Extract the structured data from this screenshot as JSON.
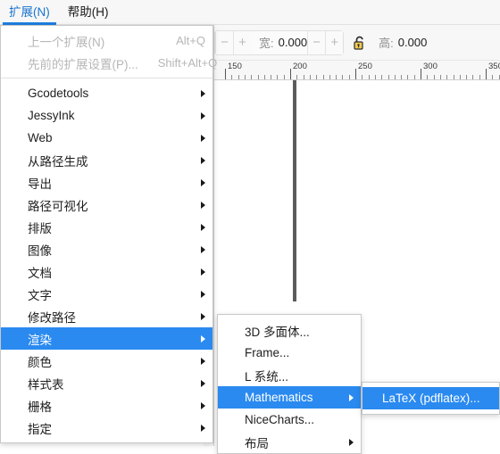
{
  "menubar": {
    "items": [
      {
        "label": "扩展(N)",
        "active": true
      },
      {
        "label": "帮助(H)",
        "active": false
      }
    ]
  },
  "toolbar": {
    "width_label": "宽:",
    "width_value": "0.000",
    "height_label": "高:",
    "height_value": "0.000",
    "lock_icon": "unlocked-padlock-icon",
    "minus_label": "−",
    "plus_label": "+"
  },
  "ruler": {
    "unit_marks": [
      "150",
      "200",
      "250",
      "300",
      "350"
    ]
  },
  "menus": {
    "extensions": {
      "title": "扩展(N)",
      "items": [
        {
          "label": "上一个扩展(N)",
          "accel": "Alt+Q",
          "disabled": true,
          "submenu": false
        },
        {
          "label": "先前的扩展设置(P)...",
          "accel": "Shift+Alt+Q",
          "disabled": true,
          "submenu": false
        },
        {
          "separator": true
        },
        {
          "label": "Gcodetools",
          "submenu": true
        },
        {
          "label": "JessyInk",
          "submenu": true
        },
        {
          "label": "Web",
          "submenu": true
        },
        {
          "label": "从路径生成",
          "submenu": true
        },
        {
          "label": "导出",
          "submenu": true
        },
        {
          "label": "路径可视化",
          "submenu": true
        },
        {
          "label": "排版",
          "submenu": true
        },
        {
          "label": "图像",
          "submenu": true
        },
        {
          "label": "文档",
          "submenu": true
        },
        {
          "label": "文字",
          "submenu": true
        },
        {
          "label": "修改路径",
          "submenu": true
        },
        {
          "label": "渲染",
          "submenu": true,
          "selected": true
        },
        {
          "label": "颜色",
          "submenu": true
        },
        {
          "label": "样式表",
          "submenu": true
        },
        {
          "label": "栅格",
          "submenu": true
        },
        {
          "label": "指定",
          "submenu": true
        }
      ]
    },
    "render": {
      "title": "渲染",
      "items": [
        {
          "label": "3D 多面体...",
          "submenu": false
        },
        {
          "label": "Frame...",
          "submenu": false
        },
        {
          "label": "L 系统...",
          "submenu": false
        },
        {
          "label": "Mathematics",
          "submenu": true,
          "selected": true
        },
        {
          "label": "NiceCharts...",
          "submenu": false
        },
        {
          "label": "布局",
          "submenu": true
        }
      ]
    },
    "mathematics": {
      "title": "Mathematics",
      "items": [
        {
          "label": "LaTeX (pdflatex)...",
          "submenu": false,
          "selected": true
        }
      ]
    }
  },
  "colors": {
    "accent": "#2a8af0",
    "menubar_active_text": "#1873cc",
    "menu_bg": "#ffffff",
    "disabled_text": "#b6b6b6",
    "toolbar_bg": "#f7f7f7"
  }
}
